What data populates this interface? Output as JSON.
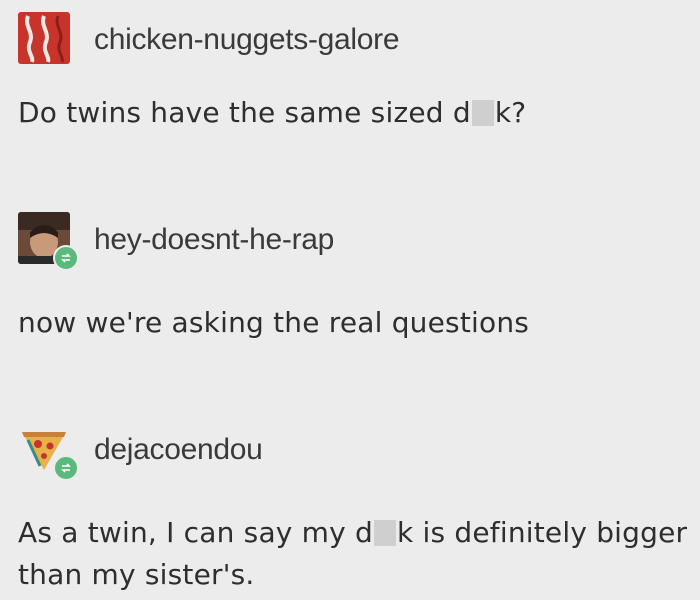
{
  "posts": [
    {
      "username": "chicken-nuggets-galore",
      "avatar_icon": "bacon-avatar-icon",
      "reblog": false,
      "text_before": "Do twins have the same sized d",
      "text_after": "k?"
    },
    {
      "username": "hey-doesnt-he-rap",
      "avatar_icon": "profile-photo-avatar",
      "reblog": true,
      "text": "now we're asking the real questions"
    },
    {
      "username": "dejacoendou",
      "avatar_icon": "pizza-slice-avatar-icon",
      "reblog": true,
      "text_before": "As a twin, I can say my d",
      "text_after": "k is definitely bigger than my sister's."
    }
  ],
  "colors": {
    "background": "#ececec",
    "reblog_badge": "#5ab97c",
    "text": "#2e2e2e"
  }
}
